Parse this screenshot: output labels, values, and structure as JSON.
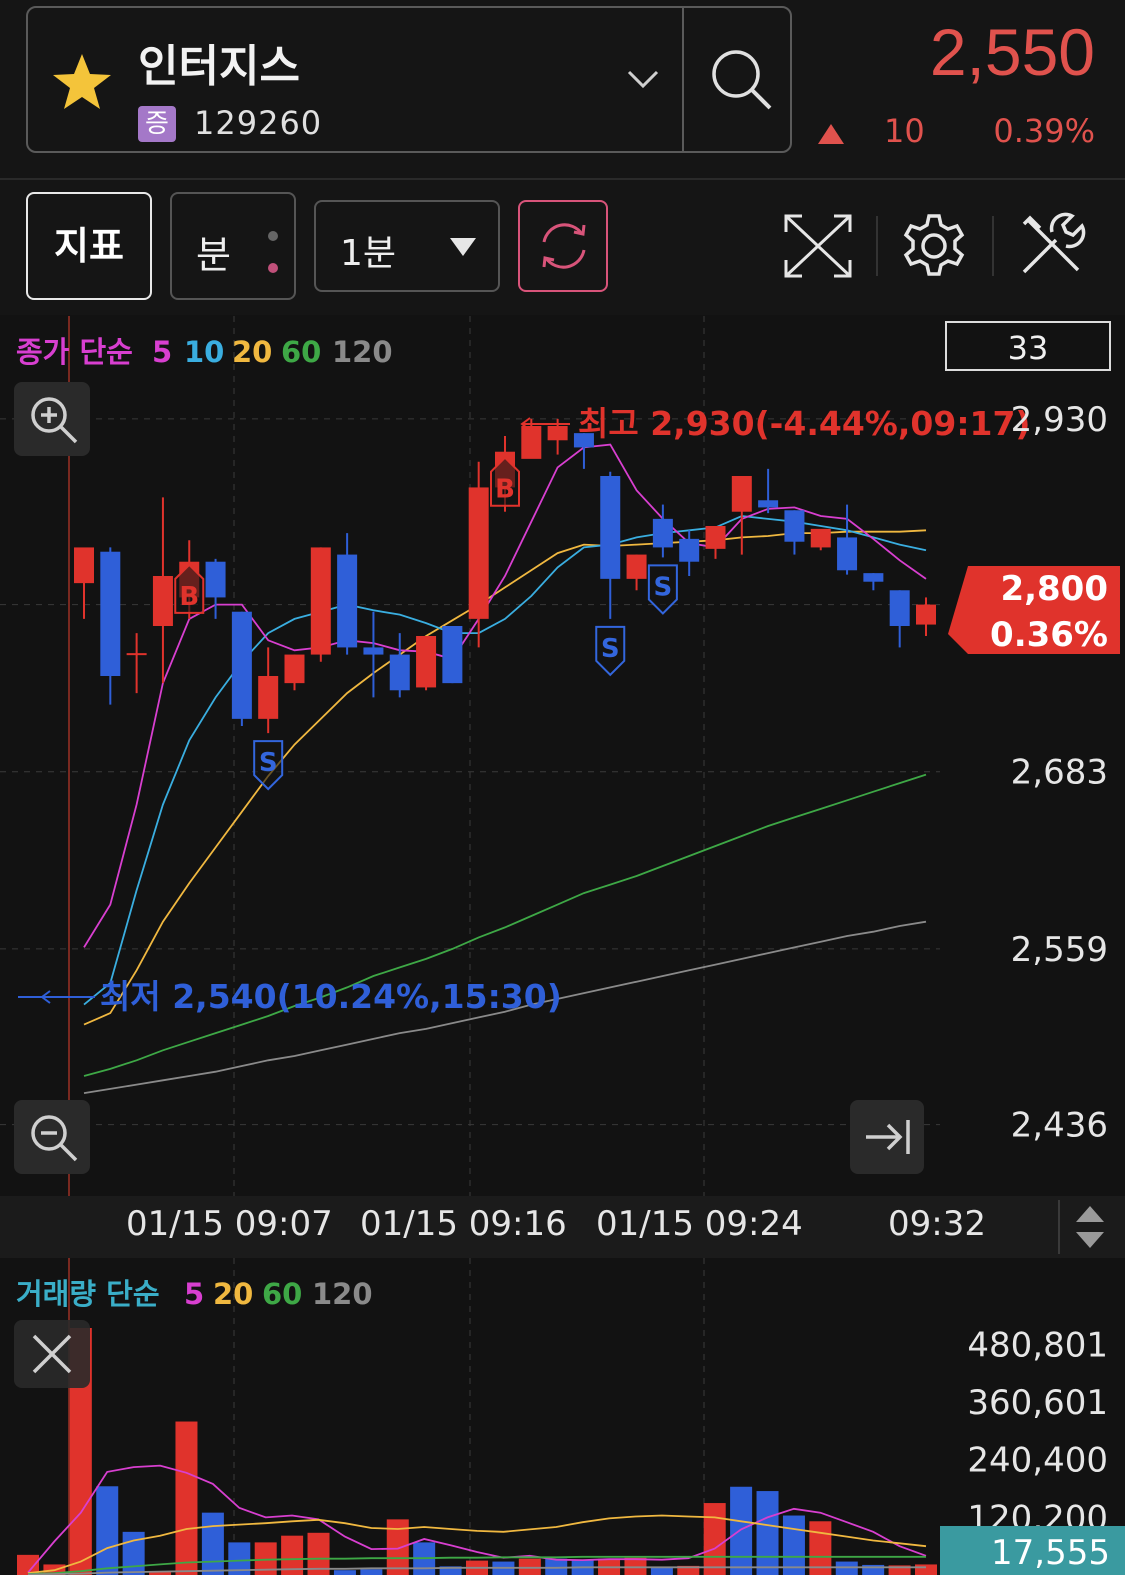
{
  "header": {
    "stock_name": "인터지스",
    "market_badge": "증",
    "stock_code": "129260",
    "price": "2,550",
    "change_value": "10",
    "change_pct": "0.39%"
  },
  "toolbar": {
    "indicator_label": "지표",
    "minute_label": "분",
    "interval_label": "1분"
  },
  "colors": {
    "up": "#e0332c",
    "down": "#2f5fd8",
    "ma5": "#d83fd0",
    "ma10": "#3aaee0",
    "ma20": "#f0b840",
    "ma60": "#3ea846",
    "ma120": "#8a8a8a",
    "accent": "#d8547a"
  },
  "price_panel": {
    "legend_prefix": "종가 단순",
    "legend_periods": [
      "5",
      "10",
      "20",
      "60",
      "120"
    ],
    "count_box": "33",
    "high_annotation": "최고 2,930(-4.44%,09:17)",
    "low_annotation": "최저 2,540(10.24%,15:30)",
    "current_price_tag": "2,800",
    "current_pct_tag": "0.36%"
  },
  "volume_panel": {
    "legend_prefix": "거래량 단순",
    "legend_periods": [
      "5",
      "20",
      "60",
      "120"
    ],
    "current_volume_tag": "17,555"
  },
  "x_axis_labels": [
    "01/15 09:07",
    "01/15 09:16",
    "01/15 09:24",
    "09:32"
  ],
  "chart_data": [
    {
      "type": "candlestick",
      "title": "",
      "y_ticks": [
        "2,930",
        "2,683",
        "2,559",
        "2,436"
      ],
      "ylim": [
        2400,
        2960
      ],
      "grid": true,
      "candles": [
        {
          "o": 2815,
          "h": 2817,
          "l": 2790,
          "c": 2840
        },
        {
          "o": 2837,
          "h": 2840,
          "l": 2730,
          "c": 2750
        },
        {
          "o": 2766,
          "h": 2780,
          "l": 2738,
          "c": 2766
        },
        {
          "o": 2785,
          "h": 2875,
          "l": 2745,
          "c": 2820
        },
        {
          "o": 2805,
          "h": 2845,
          "l": 2790,
          "c": 2830
        },
        {
          "o": 2830,
          "h": 2832,
          "l": 2790,
          "c": 2805
        },
        {
          "o": 2795,
          "h": 2795,
          "l": 2715,
          "c": 2720
        },
        {
          "o": 2720,
          "h": 2770,
          "l": 2710,
          "c": 2750
        },
        {
          "o": 2745,
          "h": 2765,
          "l": 2740,
          "c": 2765
        },
        {
          "o": 2765,
          "h": 2840,
          "l": 2760,
          "c": 2840
        },
        {
          "o": 2835,
          "h": 2850,
          "l": 2765,
          "c": 2770
        },
        {
          "o": 2770,
          "h": 2795,
          "l": 2735,
          "c": 2765
        },
        {
          "o": 2765,
          "h": 2780,
          "l": 2735,
          "c": 2740
        },
        {
          "o": 2742,
          "h": 2775,
          "l": 2740,
          "c": 2778
        },
        {
          "o": 2785,
          "h": 2785,
          "l": 2745,
          "c": 2745
        },
        {
          "o": 2790,
          "h": 2900,
          "l": 2770,
          "c": 2882
        },
        {
          "o": 2882,
          "h": 2918,
          "l": 2865,
          "c": 2907
        },
        {
          "o": 2902,
          "h": 2930,
          "l": 2905,
          "c": 2925
        },
        {
          "o": 2915,
          "h": 2930,
          "l": 2905,
          "c": 2925
        },
        {
          "o": 2920,
          "h": 2920,
          "l": 2895,
          "c": 2910
        },
        {
          "o": 2890,
          "h": 2893,
          "l": 2790,
          "c": 2818
        },
        {
          "o": 2818,
          "h": 2835,
          "l": 2810,
          "c": 2835
        },
        {
          "o": 2860,
          "h": 2870,
          "l": 2833,
          "c": 2840
        },
        {
          "o": 2846,
          "h": 2852,
          "l": 2820,
          "c": 2830
        },
        {
          "o": 2839,
          "h": 2855,
          "l": 2832,
          "c": 2855
        },
        {
          "o": 2865,
          "h": 2890,
          "l": 2835,
          "c": 2890
        },
        {
          "o": 2873,
          "h": 2895,
          "l": 2864,
          "c": 2868
        },
        {
          "o": 2866,
          "h": 2866,
          "l": 2835,
          "c": 2844
        },
        {
          "o": 2840,
          "h": 2852,
          "l": 2838,
          "c": 2853
        },
        {
          "o": 2847,
          "h": 2870,
          "l": 2821,
          "c": 2824
        },
        {
          "o": 2822,
          "h": 2822,
          "l": 2810,
          "c": 2816
        },
        {
          "o": 2810,
          "h": 2810,
          "l": 2770,
          "c": 2785
        },
        {
          "o": 2786,
          "h": 2805,
          "l": 2778,
          "c": 2800
        }
      ],
      "series": [
        {
          "name": "5",
          "values": [
            2560,
            2590,
            2660,
            2745,
            2790,
            2800,
            2800,
            2775,
            2768,
            2770,
            2775,
            2773,
            2768,
            2767,
            2762,
            2790,
            2820,
            2858,
            2896,
            2910,
            2912,
            2880,
            2860,
            2843,
            2840,
            2860,
            2867,
            2868,
            2862,
            2860,
            2846,
            2831,
            2818
          ]
        },
        {
          "name": "10",
          "values": [
            2520,
            2535,
            2600,
            2660,
            2705,
            2735,
            2760,
            2780,
            2790,
            2795,
            2800,
            2796,
            2793,
            2787,
            2780,
            2780,
            2790,
            2806,
            2826,
            2840,
            2842,
            2847,
            2850,
            2852,
            2854,
            2862,
            2860,
            2858,
            2855,
            2852,
            2847,
            2842,
            2838
          ]
        },
        {
          "name": "20",
          "values": [
            2506,
            2514,
            2544,
            2578,
            2605,
            2630,
            2655,
            2680,
            2702,
            2720,
            2738,
            2752,
            2765,
            2778,
            2789,
            2800,
            2812,
            2824,
            2836,
            2842,
            2841,
            2842,
            2843,
            2844,
            2845,
            2847,
            2848,
            2850,
            2850,
            2851,
            2851,
            2851,
            2852
          ]
        },
        {
          "name": "60",
          "values": [
            2470,
            2475,
            2481,
            2488,
            2494,
            2500,
            2506,
            2512,
            2519,
            2525,
            2532,
            2540,
            2546,
            2552,
            2559,
            2567,
            2574,
            2582,
            2590,
            2598,
            2604,
            2610,
            2617,
            2624,
            2631,
            2638,
            2645,
            2651,
            2657,
            2663,
            2669,
            2675,
            2681
          ]
        },
        {
          "name": "120",
          "values": [
            2458,
            2461,
            2464,
            2467,
            2470,
            2473,
            2477,
            2481,
            2484,
            2488,
            2492,
            2496,
            2500,
            2503,
            2507,
            2511,
            2515,
            2520,
            2524,
            2528,
            2532,
            2536,
            2540,
            2544,
            2548,
            2552,
            2556,
            2560,
            2564,
            2568,
            2571,
            2575,
            2578
          ]
        }
      ],
      "signals": [
        {
          "index": 4,
          "type": "B"
        },
        {
          "index": 7,
          "type": "S"
        },
        {
          "index": 16,
          "type": "B"
        },
        {
          "index": 20,
          "type": "S"
        },
        {
          "index": 22,
          "type": "S"
        }
      ]
    },
    {
      "type": "bar",
      "title": "",
      "y_ticks": [
        "480,801",
        "360,601",
        "240,400",
        "120,200"
      ],
      "ylim": [
        0,
        515000
      ],
      "values": [
        42000,
        22000,
        515000,
        185000,
        90000,
        8000,
        320000,
        130000,
        68000,
        68000,
        82000,
        88000,
        10000,
        12000,
        116000,
        68000,
        18000,
        30000,
        28000,
        34000,
        34000,
        32000,
        34000,
        36000,
        16000,
        19000,
        150000,
        184000,
        175000,
        124000,
        112000,
        28000,
        21000,
        20000,
        22000
      ],
      "up": [
        true,
        true,
        true,
        false,
        false,
        true,
        true,
        false,
        false,
        true,
        true,
        true,
        false,
        false,
        true,
        false,
        false,
        true,
        false,
        true,
        false,
        false,
        true,
        true,
        false,
        true,
        true,
        false,
        false,
        false,
        true,
        false,
        false,
        true,
        true
      ],
      "series": [
        {
          "name": "5",
          "values": [
            5000,
            70000,
            130000,
            215000,
            225000,
            228000,
            213000,
            190000,
            140000,
            120000,
            124000,
            116000,
            80000,
            54000,
            55000,
            75000,
            62000,
            48000,
            36000,
            40000,
            32000,
            31000,
            33000,
            33000,
            32000,
            35000,
            55000,
            95000,
            120000,
            138000,
            130000,
            110000,
            90000,
            60000,
            40000
          ]
        },
        {
          "name": "20",
          "values": [
            4000,
            10000,
            28000,
            56000,
            72000,
            82000,
            96000,
            102000,
            105000,
            108000,
            112000,
            115000,
            108000,
            98000,
            96000,
            100000,
            96000,
            92000,
            90000,
            95000,
            100000,
            110000,
            118000,
            122000,
            124000,
            122000,
            120000,
            112000,
            104000,
            96000,
            88000,
            80000,
            72000,
            66000,
            60000
          ]
        },
        {
          "name": "60",
          "values": [
            2000,
            4000,
            8000,
            14000,
            18000,
            22000,
            26000,
            28000,
            30000,
            32000,
            33000,
            34000,
            34000,
            35000,
            35000,
            35000,
            36000,
            36000,
            37000,
            37000,
            37000,
            38000,
            38000,
            38000,
            38000,
            38000,
            38000,
            38000,
            38000,
            38000,
            38000,
            38000,
            38000,
            38000,
            38000
          ]
        },
        {
          "name": "120",
          "values": [
            1000,
            2000,
            3000,
            5000,
            6000,
            7000,
            8000,
            9000,
            10000,
            11000,
            12000,
            13000,
            13000,
            14000,
            14000,
            14000,
            15000,
            15000,
            15000,
            15000,
            15000,
            16000,
            16000,
            16000,
            16000,
            16000,
            16000,
            16000,
            16000,
            16000,
            16000,
            16000,
            16000,
            16000,
            16000
          ]
        }
      ]
    }
  ]
}
